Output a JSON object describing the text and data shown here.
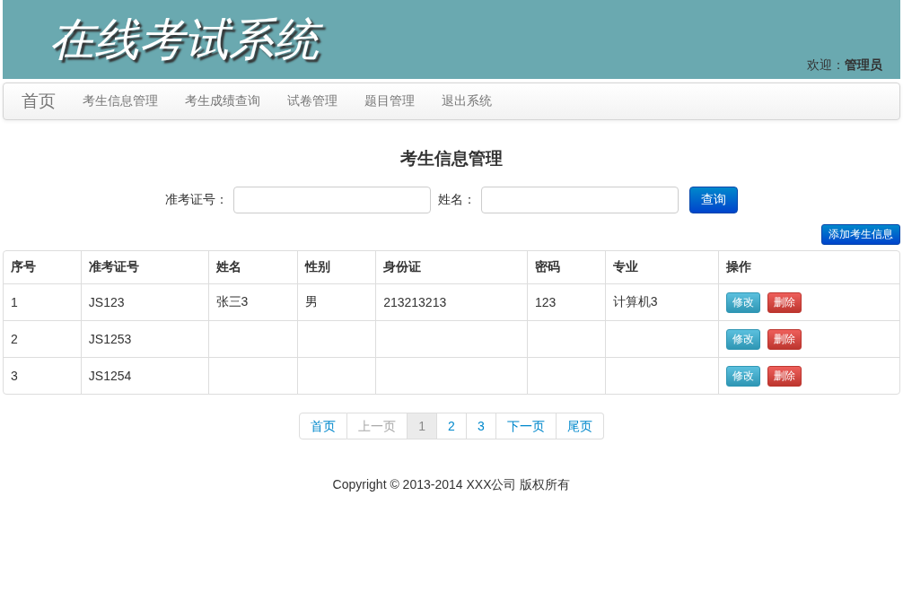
{
  "header": {
    "title": "在线考试系统",
    "welcome_label": "欢迎：",
    "user": "管理员"
  },
  "nav": {
    "brand": "首页",
    "items": [
      {
        "label": "考生信息管理"
      },
      {
        "label": "考生成绩查询"
      },
      {
        "label": "试卷管理"
      },
      {
        "label": "题目管理"
      },
      {
        "label": "退出系统"
      }
    ]
  },
  "page_title": "考生信息管理",
  "search": {
    "fields": [
      {
        "label": "准考证号："
      },
      {
        "label": "姓名："
      }
    ],
    "button": "查询"
  },
  "add_button": "添加考生信息",
  "table": {
    "columns": [
      "序号",
      "准考证号",
      "姓名",
      "性别",
      "身份证",
      "密码",
      "专业",
      "操作"
    ],
    "rows": [
      {
        "cells": [
          "1",
          "JS123",
          "张三3",
          "男",
          "213213213",
          "123",
          "计算机3"
        ],
        "actions": [
          "修改",
          "删除"
        ]
      },
      {
        "cells": [
          "2",
          "JS1253",
          null,
          null,
          null,
          null,
          null
        ],
        "actions": [
          "修改",
          "删除"
        ]
      },
      {
        "cells": [
          "3",
          "JS1254",
          null,
          null,
          null,
          null,
          null
        ],
        "actions": [
          "修改",
          "删除"
        ]
      }
    ]
  },
  "pagination": [
    {
      "label": "首页",
      "selected": false,
      "disabled": false
    },
    {
      "label": "上一页",
      "selected": false,
      "disabled": true
    },
    {
      "label": "1",
      "selected": true,
      "disabled": false
    },
    {
      "label": "2",
      "selected": false,
      "disabled": false
    },
    {
      "label": "3",
      "selected": false,
      "disabled": false
    },
    {
      "label": "下一页",
      "selected": false,
      "disabled": false
    },
    {
      "label": "尾页",
      "selected": false,
      "disabled": false
    }
  ],
  "footer": "Copyright © 2013-2014 XXX公司 版权所有"
}
